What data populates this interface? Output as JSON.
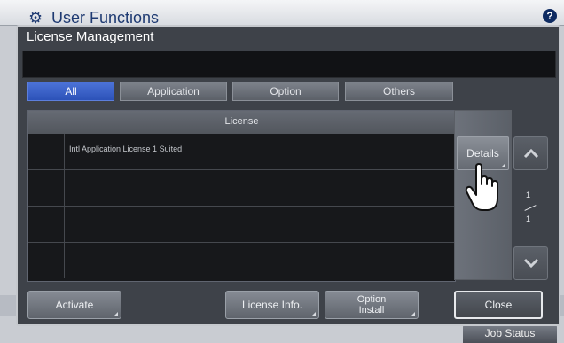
{
  "app": {
    "title": "User Functions",
    "help_label": "?"
  },
  "dialog": {
    "title": "License Management",
    "message": ""
  },
  "tabs": [
    {
      "label": "All",
      "active": true
    },
    {
      "label": "Application",
      "active": false
    },
    {
      "label": "Option",
      "active": false
    },
    {
      "label": "Others",
      "active": false
    }
  ],
  "table": {
    "header": "License",
    "rows": [
      {
        "text": "Intl Application License 1 Suited"
      },
      {
        "text": ""
      },
      {
        "text": ""
      },
      {
        "text": ""
      }
    ]
  },
  "details_label": "Details",
  "pagination": {
    "current": "1",
    "total": "1"
  },
  "buttons": {
    "activate": "Activate",
    "license_info": "License Info.",
    "option_install_line1": "Option",
    "option_install_line2": "Install",
    "close": "Close"
  },
  "job_status": "Job Status",
  "colors": {
    "active_tab": "#3a62cc",
    "dialog_bg": "#3e4249",
    "table_bg": "#17181b"
  },
  "icons": [
    "gear-icon",
    "help-icon",
    "scroll-up-icon",
    "scroll-down-icon",
    "hand-cursor-icon"
  ]
}
